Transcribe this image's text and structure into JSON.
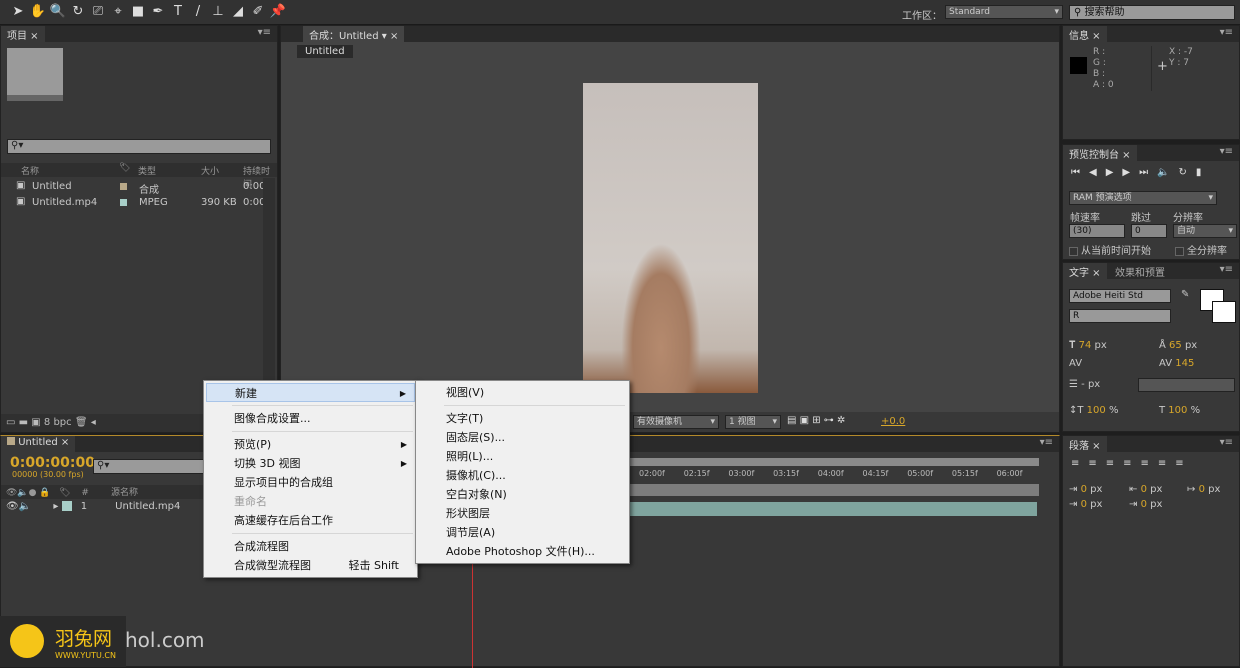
{
  "toolbar": {
    "tools": [
      "selection-icon",
      "hand-icon",
      "zoom-icon",
      "rotate-icon",
      "camera-orbit-icon",
      "pan-behind-icon",
      "rectangle-icon",
      "pen-icon",
      "text-icon",
      "brush-icon",
      "clone-stamp-icon",
      "eraser-icon",
      "roto-brush-icon",
      "puppet-pin-icon"
    ],
    "workspace_label": "工作区：",
    "workspace_value": "Standard",
    "search_placeholder": "搜索帮助"
  },
  "project": {
    "tab": "项目",
    "columns": [
      "名称",
      "类型",
      "大小",
      "持续时间"
    ],
    "rows": [
      {
        "name": "Untitled",
        "type": "合成",
        "size": "",
        "duration": "0:00",
        "color": "#b8a888"
      },
      {
        "name": "Untitled.mp4",
        "type": "MPEG",
        "size": "390 KB",
        "duration": "0:00",
        "color": "#a8cfc8"
      }
    ],
    "bpc": "8 bpc"
  },
  "comp": {
    "tab": "合成：Untitled",
    "crumb": "Untitled",
    "camera": "有效摄像机",
    "views": "1 视图",
    "exposure": "+0.0"
  },
  "info": {
    "tab": "信息",
    "r": "R :",
    "g": "G :",
    "b": "B :",
    "a": "A : 0",
    "x": "X : -7",
    "y": "Y : 7"
  },
  "preview": {
    "tab": "预览控制台",
    "ram": "RAM 预演选项",
    "fps_label": "帧速率",
    "skip_label": "跳过",
    "res_label": "分辨率",
    "fps": "(30)",
    "skip": "0",
    "res": "自动",
    "from_current": "从当前时间开始",
    "full_res": "全分辨率"
  },
  "character": {
    "tab": "文字",
    "tab2": "效果和预置",
    "font": "Adobe Heiti Std",
    "style": "R",
    "size": "74",
    "size_unit": "px",
    "leading": "65",
    "leading_unit": "px",
    "tracking": "145",
    "line_px": "- px",
    "vscale": "100",
    "hscale": "100",
    "pct": "%"
  },
  "paragraph": {
    "tab": "段落",
    "indent": [
      "0",
      "0",
      "0",
      "0",
      "0"
    ],
    "unit": "px"
  },
  "timeline": {
    "tab": "Untitled",
    "timecode": "0:00:00:00",
    "frames": "00000 (30.00 fps)",
    "col_num": "#",
    "col_src": "源名称",
    "layer_num": "1",
    "layer_name": "Untitled.mp4",
    "ticks": [
      "02:00f",
      "02:15f",
      "03:00f",
      "03:15f",
      "04:00f",
      "04:15f",
      "05:00f",
      "05:15f",
      "06:00f"
    ]
  },
  "context_menu": {
    "items": [
      {
        "label": "新建",
        "sub": true,
        "hl": true
      },
      {
        "sep": true
      },
      {
        "label": "图像合成设置..."
      },
      {
        "sep": true
      },
      {
        "label": "预览(P)",
        "sub": true
      },
      {
        "label": "切换 3D 视图",
        "sub": true
      },
      {
        "label": "显示项目中的合成组"
      },
      {
        "label": "重命名",
        "disabled": true
      },
      {
        "label": "高速缓存在后台工作"
      },
      {
        "sep": true
      },
      {
        "label": "合成流程图"
      },
      {
        "label": "合成微型流程图",
        "shortcut": "轻击 Shift"
      }
    ]
  },
  "submenu": {
    "items": [
      "视图(V)",
      "文字(T)",
      "固态层(S)...",
      "照明(L)...",
      "摄像机(C)...",
      "空白对象(N)",
      "形状图层",
      "调节层(A)",
      "Adobe Photoshop 文件(H)..."
    ]
  },
  "watermark": {
    "brand": "羽兔网",
    "url": "WWW.YUTU.CN",
    "behind": "hol.com"
  }
}
